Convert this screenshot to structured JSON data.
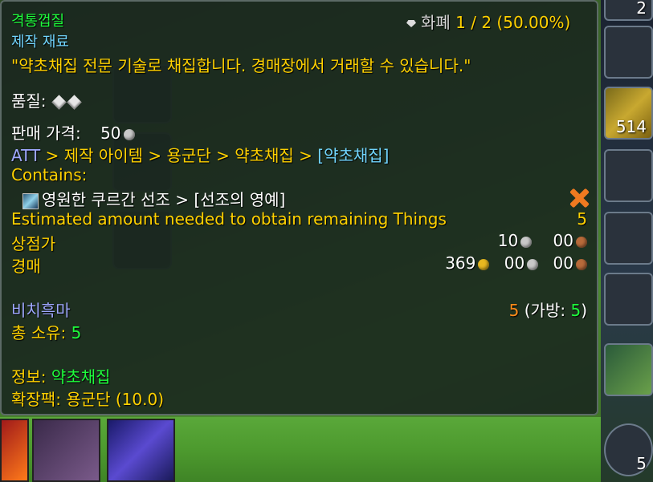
{
  "background": {
    "right_slots": [
      {
        "name": "top-slot",
        "count": "2"
      },
      {
        "name": "weapon-slot",
        "count": ""
      },
      {
        "name": "gold-material-slot",
        "count": "514"
      },
      {
        "name": "wing-slot-1",
        "count": ""
      },
      {
        "name": "wing-slot-2",
        "count": ""
      },
      {
        "name": "wing-slot-3",
        "count": ""
      },
      {
        "name": "bag-slot",
        "count": ""
      },
      {
        "name": "bottom-slot",
        "count": "5"
      }
    ]
  },
  "tooltip": {
    "item_name": "격통껍질",
    "item_type": "제작 재료",
    "currency_label": "화폐",
    "currency_value": "1 / 2 (50.00%)",
    "description": "\"약초채집 전문 기술로 채집합니다. 경매장에서 거래할 수 있습니다.\"",
    "quality_label": "품질:",
    "sell_price_label": "판매 가격:",
    "sell_price_value": "50",
    "breadcrumb": {
      "prefix": "ATT",
      "path": "> 제작 아이템 > 용군단 > 약초채집 >",
      "current": "[약초채집]"
    },
    "contains_label": "Contains:",
    "contains_item": "영원한 쿠르간 선조 > [선조의 영예]",
    "estimated_label": "Estimated amount needed to obtain remaining Things",
    "estimated_value": "5",
    "vendor_label": "상점가",
    "vendor_silver": "10",
    "vendor_copper": "00",
    "auction_label": "경매",
    "auction_gold": "369",
    "auction_silver": "00",
    "auction_copper": "00",
    "character_name": "비치흑마",
    "character_count": "5",
    "bag_label_open": "(가방:",
    "bag_count": "5",
    "bag_label_close": ")",
    "total_owned_label": "총 소유:",
    "total_owned_value": "5",
    "info_label": "정보:",
    "info_value": "약초채집",
    "expansion_label": "확장팩:",
    "expansion_value": "용군단 (10.0)"
  },
  "colors": {
    "title": "#1eff3c",
    "category": "#71d5ff",
    "gold_text": "#ffd100",
    "tooltip_bg": "#18241e"
  }
}
